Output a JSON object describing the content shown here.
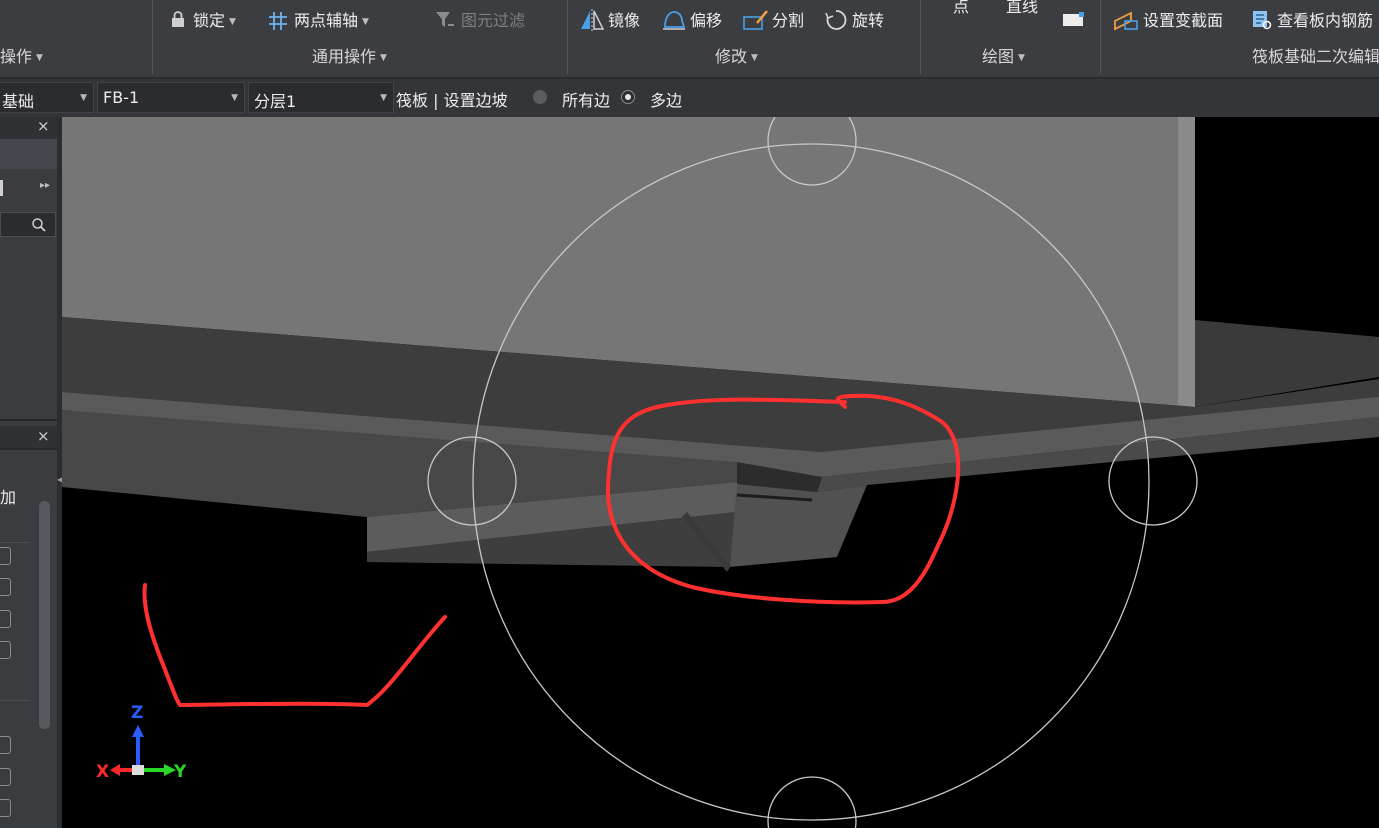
{
  "ribbon": {
    "lock_label": "锁定",
    "two_point_axis_label": "两点辅轴",
    "element_filter_label": "图元过滤",
    "mirror_label": "镜像",
    "offset_label": "偏移",
    "split_label": "分割",
    "rotate_label": "旋转",
    "point_label": "点",
    "line_label": "直线",
    "set_slope_face_label": "设置变截面",
    "view_rebar_label": "查看板内钢筋",
    "groups": {
      "operate": "操作",
      "common_ops": "通用操作",
      "modify": "修改",
      "draw": "绘图",
      "raft_edit": "筏板基础二次编辑"
    }
  },
  "toolbar": {
    "category": "基础",
    "element": "FB-1",
    "layer": "分层1",
    "status": "筏板 | 设置边坡",
    "radio_all_edges": "所有边",
    "radio_multi_edges": "多边",
    "selected_option": "多边"
  },
  "left_panel": {
    "close_1": "×",
    "close_2": "×",
    "add_label": "加"
  },
  "viewport": {
    "axis_x": "X",
    "axis_y": "Y",
    "axis_z": "Z"
  },
  "colors": {
    "ribbon_bg": "#3b3d40",
    "viewport_bg": "#000000",
    "annotation": "#ff3030",
    "accent_blue": "#4a9fe8"
  }
}
